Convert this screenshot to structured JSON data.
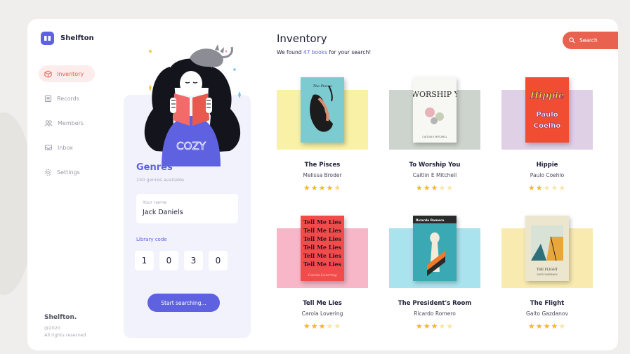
{
  "app": {
    "name": "Shelfton"
  },
  "nav": [
    {
      "label": "Inventory",
      "icon": "box-icon",
      "active": true
    },
    {
      "label": "Records",
      "icon": "records-icon",
      "active": false
    },
    {
      "label": "Members",
      "icon": "members-icon",
      "active": false
    },
    {
      "label": "Inbox",
      "icon": "inbox-icon",
      "active": false
    },
    {
      "label": "Settings",
      "icon": "gear-icon",
      "active": false
    }
  ],
  "footer": {
    "name": "Shelfton.",
    "year": "@2020",
    "rights": "All rights reserved"
  },
  "card": {
    "illustration_text": "COZY",
    "genres_title": "Genres",
    "genres_sub": "150 genres available",
    "name_label": "Your name",
    "name_value": "Jack Daniels",
    "code_label": "Library code",
    "code": [
      "1",
      "0",
      "3",
      "0"
    ],
    "start_button": "Start searching..."
  },
  "inventory": {
    "title": "Inventory",
    "sub_prefix": "We found ",
    "count": "47 books",
    "sub_suffix": " for your search!",
    "search_label": "Search"
  },
  "books": [
    {
      "title": "The Pisces",
      "author": "Melissa Broder",
      "rating": 4.5,
      "bg": "#f9f1a5",
      "cover": "#7ccbd0"
    },
    {
      "title": "To Worship You",
      "author": "Caitlin E Mitchell",
      "rating": 3,
      "bg": "#cdd4cd",
      "cover": "#f7f7f4",
      "cover_title": "TO WORSHIP YOU",
      "cover_author": "CAITLIN E MITCHELL"
    },
    {
      "title": "Hippie",
      "author": "Paulo Coehlo",
      "rating": 2,
      "bg": "#dfd0e6",
      "cover": "#f04d32",
      "cover_title": "Hippie",
      "cover_author": "Paulo Coelho"
    },
    {
      "title": "Tell Me Lies",
      "author": "Carola Lovering",
      "rating": 3,
      "bg": "#f7b7c8",
      "cover": "#f24b4b",
      "cover_title": "Tell Me Lies",
      "cover_author": "Carola Lovering"
    },
    {
      "title": "The President's Room",
      "author": "Ricardo Romero",
      "rating": 3,
      "bg": "#a9e4ee",
      "cover": "#3aa9b3",
      "cover_title": "Ricardo Romero"
    },
    {
      "title": "The Flight",
      "author": "Gaito Gazdanov",
      "rating": 4,
      "bg": "#f9ebb0",
      "cover": "#ece6cf",
      "cover_title": "THE FLIGHT",
      "cover_author": "GAITO GAZDANOV"
    }
  ]
}
